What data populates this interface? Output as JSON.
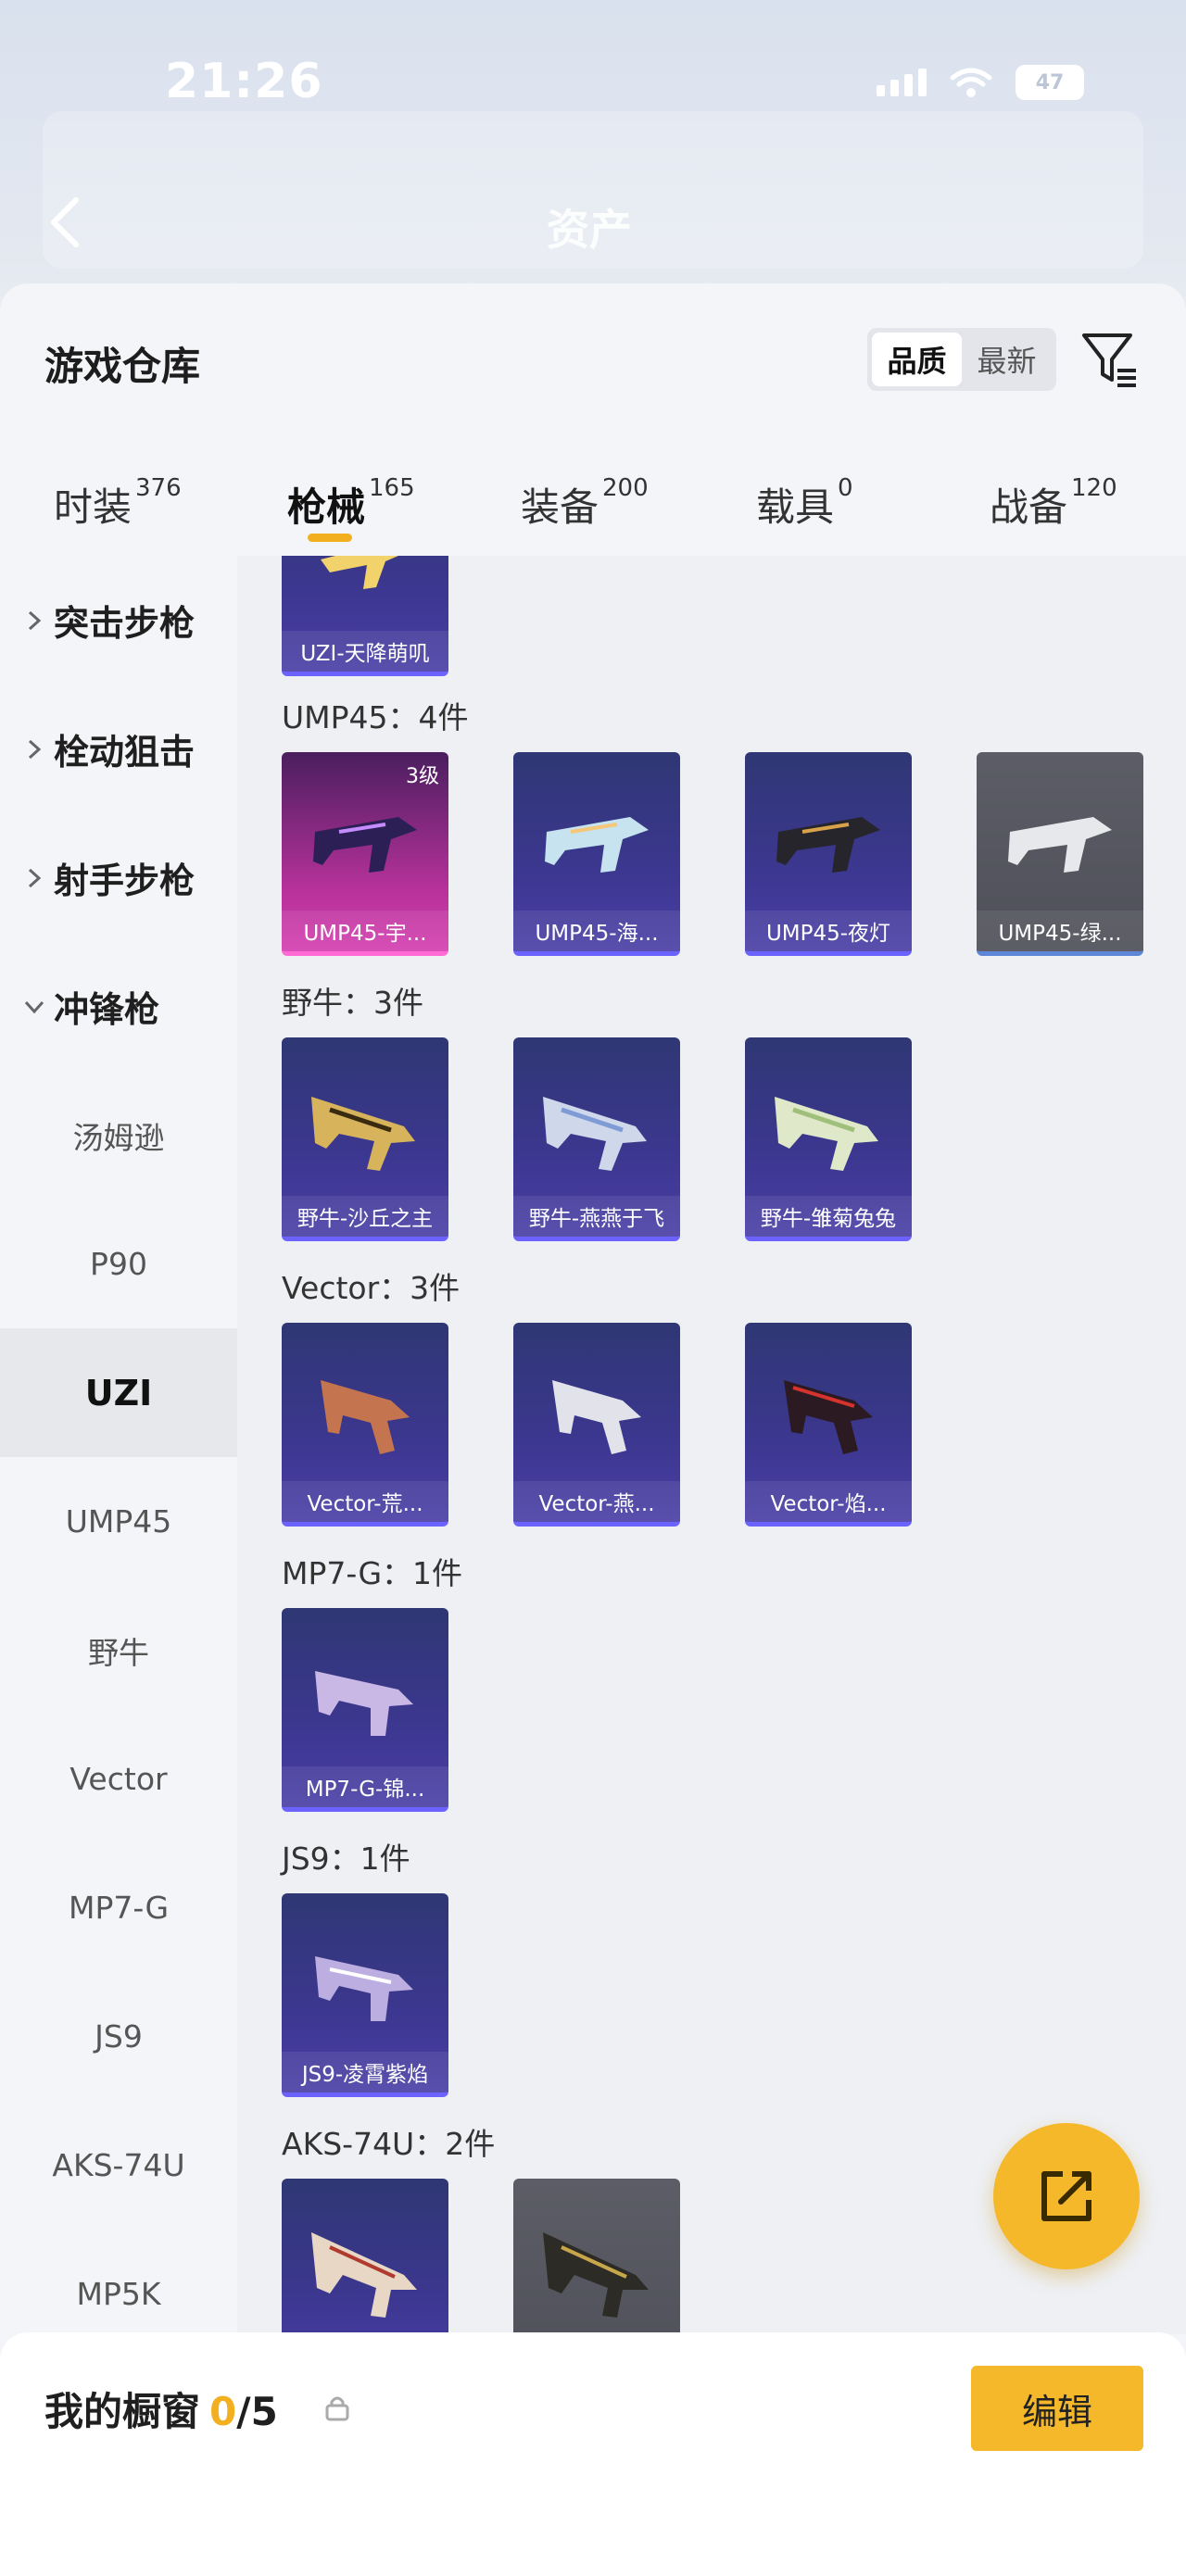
{
  "status_bar": {
    "time": "21:26",
    "battery": "47"
  },
  "header": {
    "title": "资产"
  },
  "warehouse": {
    "title": "游戏仓库",
    "sort": {
      "quality": "品质",
      "newest": "最新"
    }
  },
  "tabs": [
    {
      "label": "时装",
      "count": "376"
    },
    {
      "label": "枪械",
      "count": "165"
    },
    {
      "label": "装备",
      "count": "200"
    },
    {
      "label": "载具",
      "count": "0"
    },
    {
      "label": "战备",
      "count": "120"
    }
  ],
  "sidebar": {
    "categories": [
      "突击步枪",
      "栓动狙击",
      "射手步枪",
      "冲锋枪"
    ],
    "subitems": [
      "汤姆逊",
      "P90",
      "UZI",
      "UMP45",
      "野牛",
      "Vector",
      "MP7-G",
      "JS9",
      "AKS-74U",
      "MP5K"
    ]
  },
  "groups": [
    {
      "title": "UMP45：4件"
    },
    {
      "title": "野牛：3件"
    },
    {
      "title": "Vector：3件"
    },
    {
      "title": "MP7-G：1件"
    },
    {
      "title": "JS9：1件"
    },
    {
      "title": "AKS-74U：2件"
    }
  ],
  "cards": {
    "uzi_top": "UZI-天降萌叽",
    "ump1": "UMP45-宇...",
    "ump1_level": "3级",
    "ump2": "UMP45-海...",
    "ump3": "UMP45-夜灯",
    "ump4": "UMP45-绿...",
    "bison1": "野牛-沙丘之主",
    "bison2": "野牛-燕燕于飞",
    "bison3": "野牛-雏菊兔兔",
    "vector1": "Vector-荒...",
    "vector2": "Vector-燕...",
    "vector3": "Vector-焰...",
    "mp7": "MP7-G-锦...",
    "js9": "JS9-凌霄紫焰"
  },
  "bottom": {
    "label": "我的橱窗",
    "used": "0",
    "total": "/5",
    "edit": "编辑"
  }
}
